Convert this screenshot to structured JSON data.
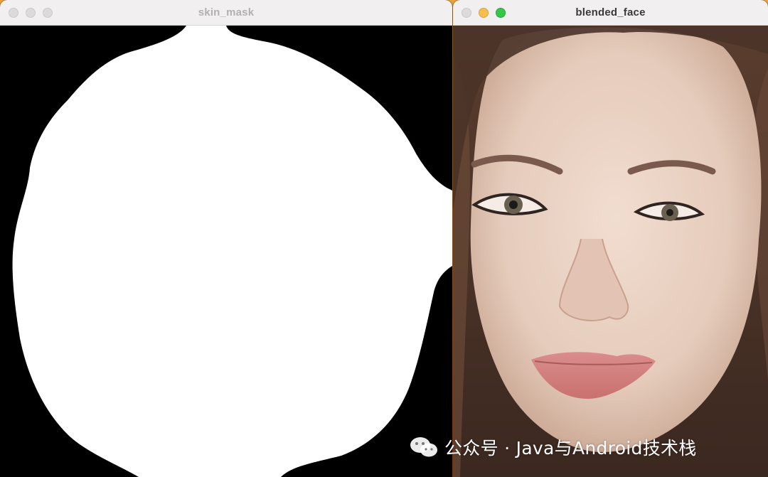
{
  "windows": [
    {
      "title": "skin_mask",
      "active": false
    },
    {
      "title": "blended_face",
      "active": true
    }
  ],
  "watermark": {
    "icon": "wechat-icon",
    "text": "公众号 · Java与Android技术栈"
  },
  "colors": {
    "desktop": "#e98a2e",
    "mask_fg": "#ffffff",
    "mask_bg": "#000000",
    "traffic_yellow": "#f4bf4f",
    "traffic_green": "#34c84a"
  }
}
